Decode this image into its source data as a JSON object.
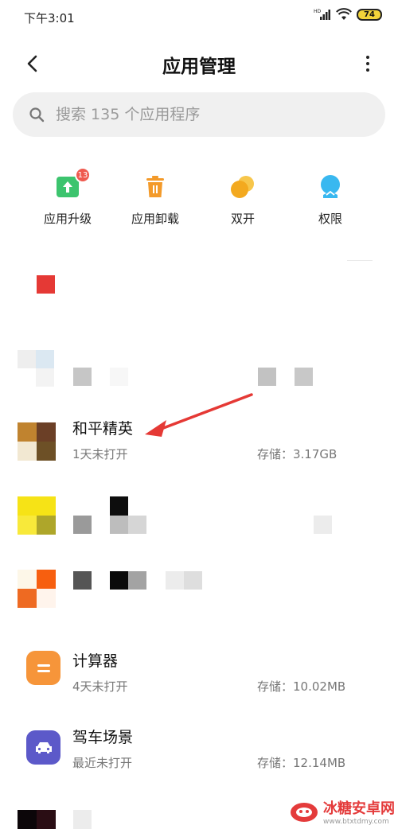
{
  "status_bar": {
    "time": "下午3:01",
    "network": "HD",
    "battery": "74"
  },
  "header": {
    "title": "应用管理"
  },
  "search": {
    "placeholder": "搜索 135 个应用程序"
  },
  "quick_actions": [
    {
      "label": "应用升级",
      "icon": "upgrade-icon",
      "badge": "13",
      "color": "#3cc46e"
    },
    {
      "label": "应用卸载",
      "icon": "trash-icon",
      "color": "#f39a2a"
    },
    {
      "label": "双开",
      "icon": "dual-app-icon",
      "color": "#f5b82a"
    },
    {
      "label": "权限",
      "icon": "permission-icon",
      "color": "#39b8f0"
    }
  ],
  "apps": [
    {
      "name": "和平精英",
      "last_opened": "1天未打开",
      "storage": "存储：3.17GB"
    },
    {
      "name": "计算器",
      "last_opened": "4天未打开",
      "storage": "存储：10.02MB",
      "icon_color": "#f6953a"
    },
    {
      "name": "驾车场景",
      "last_opened": "最近未打开",
      "storage": "存储：12.14MB",
      "icon_color": "#5c59c9"
    }
  ],
  "watermark": {
    "title": "冰糖安卓网",
    "url": "www.btxtdmy.com"
  }
}
